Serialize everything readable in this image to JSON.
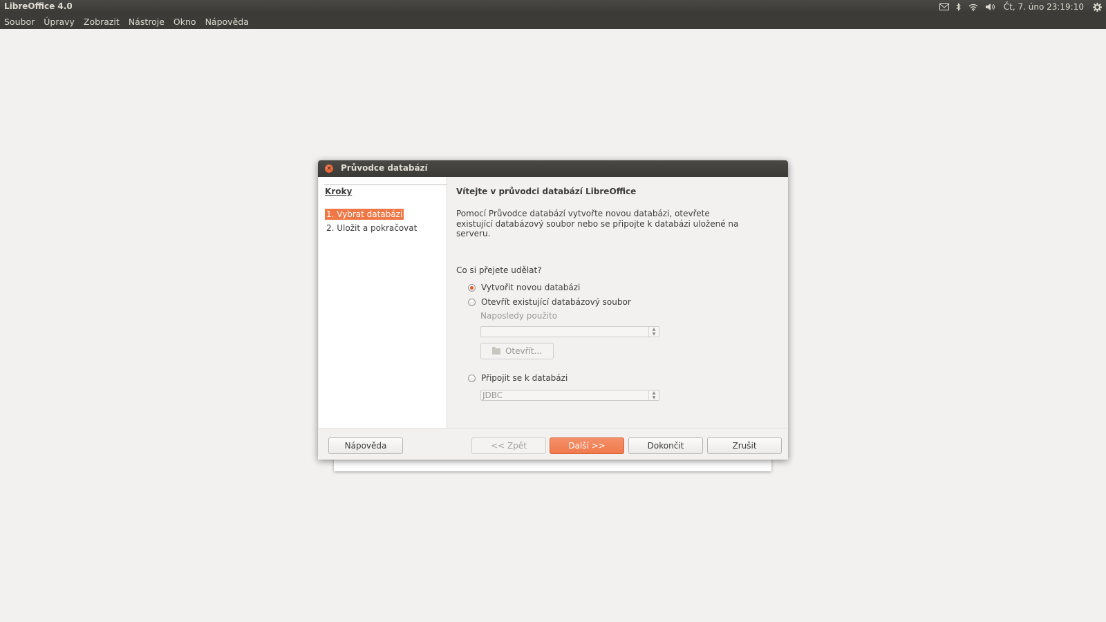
{
  "top_panel": {
    "app_title": "LibreOffice 4.0",
    "indicators": [
      "mail-icon",
      "bluetooth-icon",
      "wifi-icon",
      "volume-icon"
    ],
    "clock": "Čt, 7. úno 23:19:10",
    "settings_icon": "gear-icon"
  },
  "menu": {
    "items": [
      "Soubor",
      "Úpravy",
      "Zobrazit",
      "Nástroje",
      "Okno",
      "Nápověda"
    ]
  },
  "dialog": {
    "title": "Průvodce databází",
    "steps": {
      "header": "Kroky",
      "items": [
        "1. Vybrat databázi",
        "2. Uložit a pokračovat"
      ],
      "active_index": 0
    },
    "content": {
      "title": "Vítejte v průvodci databází LibreOffice",
      "description": "Pomocí Průvodce databází vytvořte novou databázi, otevřete existující databázový soubor nebo se připojte k databázi uložené na serveru.",
      "question": "Co si přejete udělat?",
      "options": {
        "create_new": "Vytvořit novou databázi",
        "open_existing": "Otevřít existující databázový soubor",
        "connect": "Připojit se k databázi"
      },
      "selected_option": "create_new",
      "recently_used_label": "Naposledy použito",
      "recently_used_value": "",
      "open_button": "Otevřít...",
      "connection_type_value": "JDBC"
    },
    "buttons": {
      "help": "Nápověda",
      "back": "<< Zpět",
      "next": "Další >>",
      "finish": "Dokončit",
      "cancel": "Zrušit"
    }
  }
}
